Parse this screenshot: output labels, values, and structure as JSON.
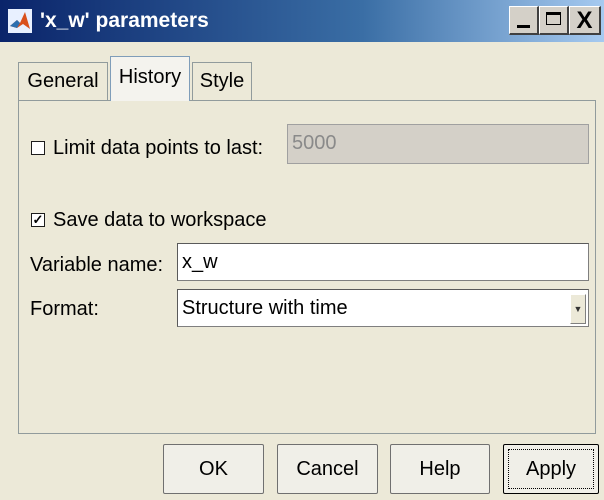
{
  "window": {
    "title": "'x_w' parameters",
    "minimize_icon": "minimize-icon",
    "maximize_icon": "maximize-icon",
    "close_glyph": "X"
  },
  "tabs": [
    {
      "label": "General",
      "selected": false
    },
    {
      "label": "History",
      "selected": true
    },
    {
      "label": "Style",
      "selected": false
    }
  ],
  "history": {
    "limit": {
      "label": "Limit data points to last:",
      "checked": false,
      "value": "5000",
      "enabled": false
    },
    "save": {
      "label": "Save data to workspace",
      "checked": true
    },
    "variable_name": {
      "label": "Variable name:",
      "value": "x_w"
    },
    "format": {
      "label": "Format:",
      "value": "Structure with time"
    }
  },
  "buttons": {
    "ok": "OK",
    "cancel": "Cancel",
    "help": "Help",
    "apply": "Apply"
  },
  "colors": {
    "titlebar_start": "#0a246a",
    "titlebar_end": "#a6caf0",
    "window_bg": "#ece9d8"
  }
}
